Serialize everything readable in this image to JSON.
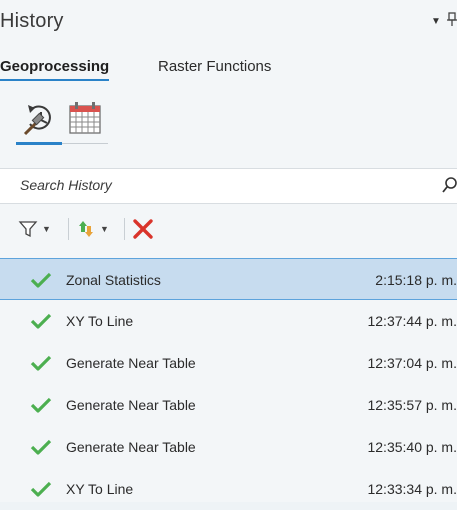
{
  "pane": {
    "title": "History"
  },
  "tabs": [
    {
      "label": "Geoprocessing",
      "active": true
    },
    {
      "label": "Raster Functions",
      "active": false
    }
  ],
  "view_switch": {
    "items": [
      {
        "icon": "history-icon",
        "selected": true
      },
      {
        "icon": "calendar-icon",
        "selected": false
      }
    ]
  },
  "search": {
    "placeholder": "Search History",
    "value": ""
  },
  "toolbar": {
    "filter_icon": "filter-icon",
    "sort_icon": "sort-icon",
    "delete_icon": "delete-icon"
  },
  "colors": {
    "accent": "#2a82c8",
    "selected_row": "#c7dcef",
    "success": "#4caf50",
    "delete": "#d9342b"
  },
  "history": [
    {
      "name": "Zonal Statistics",
      "time": "2:15:18 p. m.",
      "status": "success",
      "selected": true
    },
    {
      "name": "XY To Line",
      "time": "12:37:44 p. m.",
      "status": "success",
      "selected": false
    },
    {
      "name": "Generate Near Table",
      "time": "12:37:04 p. m.",
      "status": "success",
      "selected": false
    },
    {
      "name": "Generate Near Table",
      "time": "12:35:57 p. m.",
      "status": "success",
      "selected": false
    },
    {
      "name": "Generate Near Table",
      "time": "12:35:40 p. m.",
      "status": "success",
      "selected": false
    },
    {
      "name": "XY To Line",
      "time": "12:33:34 p. m.",
      "status": "success",
      "selected": false
    }
  ]
}
